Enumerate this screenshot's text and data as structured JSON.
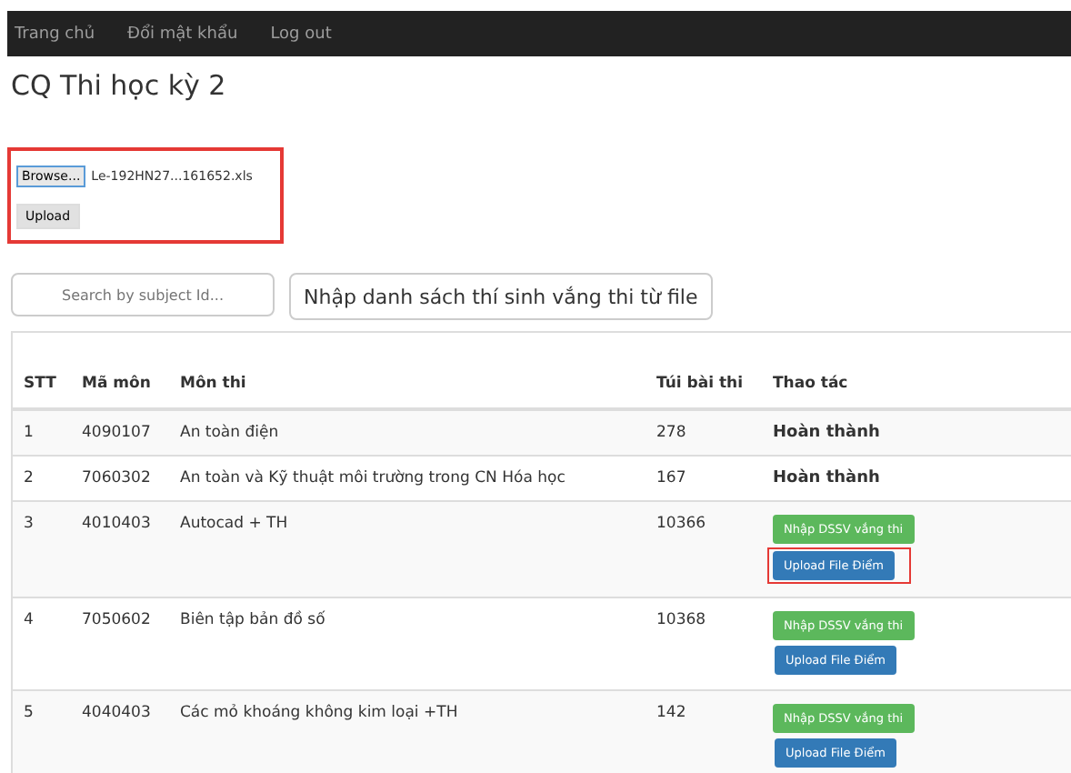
{
  "nav": {
    "items": [
      "Trang chủ",
      "Đổi mật khẩu",
      "Log out"
    ]
  },
  "title": "CQ Thi học kỳ 2",
  "upload": {
    "highlighted": true,
    "browse": "Browse...",
    "file_name": "Le-192HN27...161652.xls",
    "button": "Upload"
  },
  "search": {
    "placeholder": "Search by subject Id..."
  },
  "import_button": "Nhập danh sách thí sinh vắng thi từ file",
  "table": {
    "columns": [
      "STT",
      "Mã môn",
      "Môn thi",
      "Túi bài thi",
      "Thao tác"
    ],
    "rows": [
      {
        "stt": "1",
        "code": "4090107",
        "subject": "An toàn điện",
        "bag": "278",
        "action": {
          "kind": "done",
          "text": "Hoàn thành"
        }
      },
      {
        "stt": "2",
        "code": "7060302",
        "subject": "An toàn và Kỹ thuật môi trường trong CN Hóa học",
        "bag": "167",
        "action": {
          "kind": "done",
          "text": "Hoàn thành"
        }
      },
      {
        "stt": "3",
        "code": "4010403",
        "subject": "Autocad + TH",
        "bag": "10366",
        "action": {
          "kind": "buttons",
          "absent": "Nhập DSSV vắng thi",
          "upload": "Upload File Điểm",
          "highlighted": true
        }
      },
      {
        "stt": "4",
        "code": "7050602",
        "subject": "Biên tập bản đồ số",
        "bag": "10368",
        "action": {
          "kind": "buttons",
          "absent": "Nhập DSSV vắng thi",
          "upload": "Upload File Điểm",
          "highlighted": false
        }
      },
      {
        "stt": "5",
        "code": "4040403",
        "subject": "Các mỏ khoáng không kim loại +TH",
        "bag": "142",
        "action": {
          "kind": "buttons",
          "absent": "Nhập DSSV vắng thi",
          "upload": "Upload File Điểm",
          "highlighted": false
        }
      }
    ]
  }
}
